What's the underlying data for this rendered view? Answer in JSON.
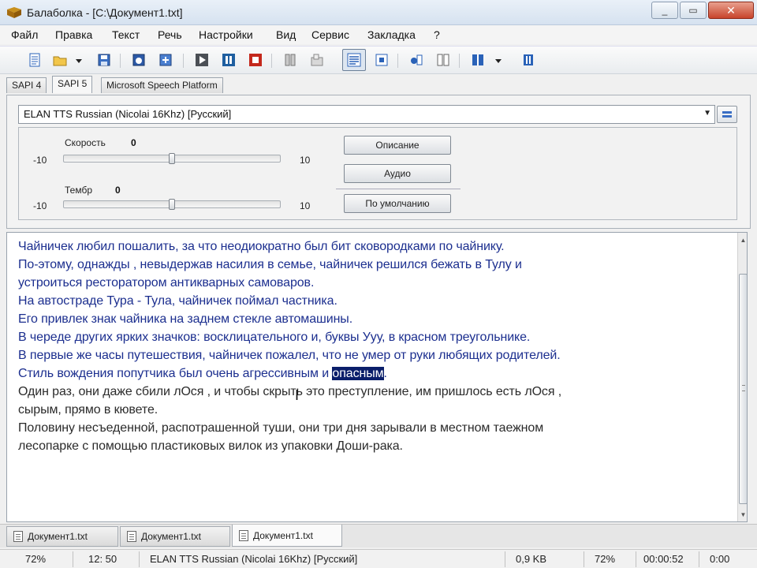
{
  "window": {
    "title": "Балаболка - [C:\\Документ1.txt]",
    "minimize": "_",
    "maximize": "▭",
    "close": "✕"
  },
  "menu": [
    "Файл",
    "Правка",
    "Текст",
    "Речь",
    "Настройки",
    "Вид",
    "Сервис",
    "Закладка",
    "?"
  ],
  "toolbar": {
    "icons": [
      "new-doc-icon",
      "open-folder-icon",
      "dropdown-arrow-icon",
      "save-icon",
      "save-audio-icon",
      "export-icon",
      "play-icon",
      "pause-icon",
      "stop-icon",
      "split-icon",
      "tile-icon",
      "text-panel-icon",
      "text-file-icon",
      "voice-settings-icon",
      "pronunciation-icon",
      "dictionary-icon",
      "book-icon",
      "dropdown-arrow-icon",
      "bookmark-icon"
    ]
  },
  "engine_tabs": [
    "SAPI 4",
    "SAPI 5",
    "Microsoft Speech Platform"
  ],
  "voice": {
    "selected": "ELAN TTS Russian (Nicolai 16Khz) [Русский]"
  },
  "speed": {
    "label": "Скорость",
    "value": "0",
    "min": "-10",
    "max": "10",
    "level": 0
  },
  "pitch": {
    "label": "Тембр",
    "value": "0",
    "min": "-10",
    "max": "10",
    "level": 0
  },
  "buttons": {
    "description": "Описание",
    "audio": "Аудио",
    "default": "По умолчанию"
  },
  "document": {
    "read_lines": [
      "Чайничек любил пошалить, за что неодиократно был бит сковородками по чайнику.",
      "По-этому, однажды , невыдержав насилия в семье, чайничек решился бежать в Тулу и",
      "устроиться ресторатором антикварных самоваров.",
      "На автостраде Тура - Тула, чайничек поймал частника.",
      "Его привлек знак чайника на заднем стекле автомашины.",
      "В череде других ярких значков: восклицательного и, буквы Ууу, в красном треугольнике.",
      "В первые же часы путешествия, чайничек пожалел, что не умер от руки любящих родителей."
    ],
    "current_line_prefix": "Стиль вождения попутчика был очень агрессивным и ",
    "current_word": "опасным",
    "current_line_suffix": ".",
    "unread_lines": [
      "Один раз, они даже сбили лОся , и чтобы скрыть это преступление, им пришлось есть лОся ,",
      "сырым, прямо в кювете.",
      "Половину несъеденной, распотрашенной туши, они три дня зарывали в местном таежном",
      "лесопарке с помощью пластиковых вилок из упаковки Доши-рака."
    ]
  },
  "doc_tabs": [
    "Документ1.txt",
    "Документ1.txt",
    "Документ1.txt"
  ],
  "status": {
    "zoom": "72%",
    "position": "12:  50",
    "voice": "ELAN TTS Russian (Nicolai 16Khz) [Русский]",
    "size": "0,9 KB",
    "progress": "72%",
    "elapsed": "00:00:52",
    "remaining": "0:00"
  }
}
